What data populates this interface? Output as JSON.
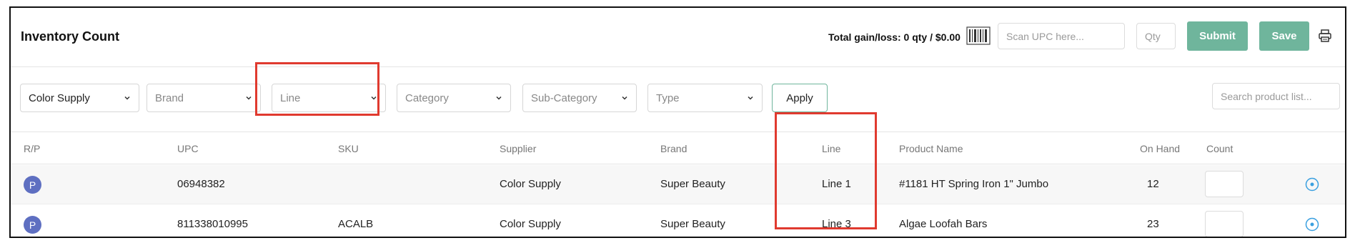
{
  "header": {
    "title": "Inventory Count",
    "gain_loss": "Total gain/loss: 0 qty / $0.00",
    "scan_placeholder": "Scan UPC here...",
    "qty_placeholder": "Qty",
    "submit_label": "Submit",
    "save_label": "Save"
  },
  "filters": {
    "supplier": "Color Supply",
    "brand": "Brand",
    "line": "Line",
    "category": "Category",
    "subcategory": "Sub-Category",
    "type": "Type",
    "apply_label": "Apply",
    "search_placeholder": "Search product list..."
  },
  "table": {
    "columns": {
      "rp": "R/P",
      "upc": "UPC",
      "sku": "SKU",
      "supplier": "Supplier",
      "brand": "Brand",
      "line": "Line",
      "product_name": "Product Name",
      "on_hand": "On Hand",
      "count": "Count"
    },
    "rows": [
      {
        "rp": "P",
        "upc": "06948382",
        "sku": "",
        "supplier": "Color Supply",
        "brand": "Super Beauty",
        "line": "Line 1",
        "product_name": "#1181 HT Spring Iron 1\" Jumbo",
        "on_hand": "12",
        "count": ""
      },
      {
        "rp": "P",
        "upc": "811338010995",
        "sku": "ACALB",
        "supplier": "Color Supply",
        "brand": "Super Beauty",
        "line": "Line 3",
        "product_name": "Algae Loofah Bars",
        "on_hand": "23",
        "count": ""
      }
    ]
  },
  "colors": {
    "accent_green": "#6fb59c",
    "badge_purple": "#5e6fc1",
    "highlight_red": "#e03a2f",
    "radio_blue": "#3aa0e0"
  },
  "icons": [
    "barcode-icon",
    "printer-icon",
    "chevron-down-icon",
    "radio-target-icon"
  ]
}
